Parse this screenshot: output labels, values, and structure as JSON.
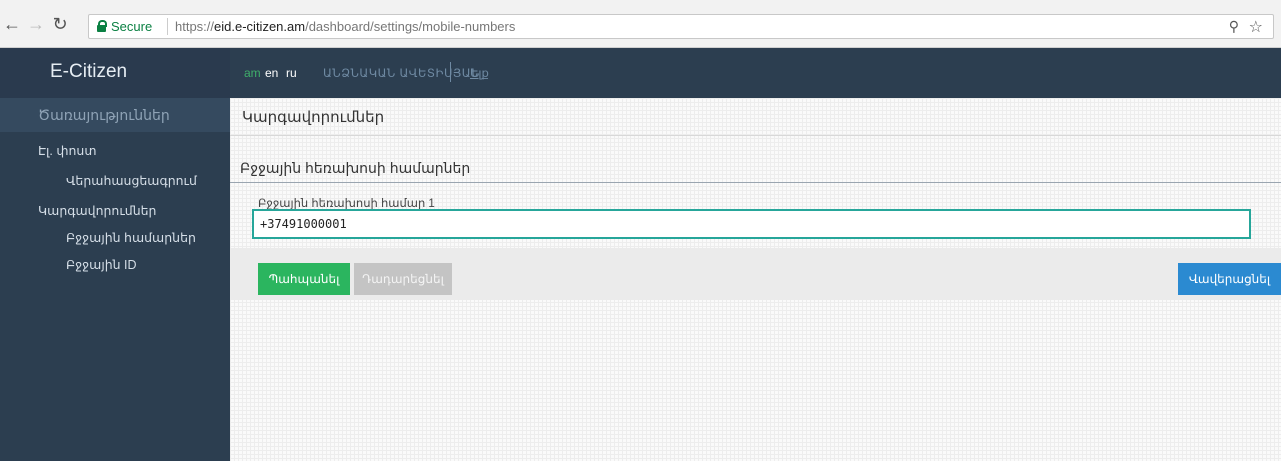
{
  "browser": {
    "secure_label": "Secure",
    "url_scheme": "https://",
    "url_host": "eid.e-citizen.am",
    "url_path": "/dashboard/settings/mobile-numbers"
  },
  "sidebar": {
    "brand": "E-Citizen",
    "section": "Ծառայություններ",
    "items": [
      {
        "label": "Էլ. փոստ"
      },
      {
        "label": "Վերահասցեագրում"
      },
      {
        "label": "Կարգավորումներ"
      },
      {
        "label": "Բջջային համարներ"
      },
      {
        "label": "Բջջային ID"
      }
    ]
  },
  "topbar": {
    "lang_am": "am",
    "lang_en": "en",
    "lang_ru": "ru",
    "profile": "ԱՆՁՆԱԿԱՆ ԱՎԵՏԻՍՅԱՆ",
    "logout": "Ելք"
  },
  "main": {
    "page_title": "Կարգավորումներ",
    "section_title": "Բջջային հեռախոսի համարներ",
    "field_label": "Բջջային հեռախոսի համար 1",
    "field_value": "+37491000001",
    "save_label": "Պահպանել",
    "reset_label": "Դադարեցնել",
    "confirm_label": "Վավերացնել"
  },
  "colors": {
    "sidebar_bg": "#2c3e50",
    "accent_green": "#2bb55f",
    "accent_blue": "#2b8ad1",
    "input_border": "#26a69a"
  }
}
